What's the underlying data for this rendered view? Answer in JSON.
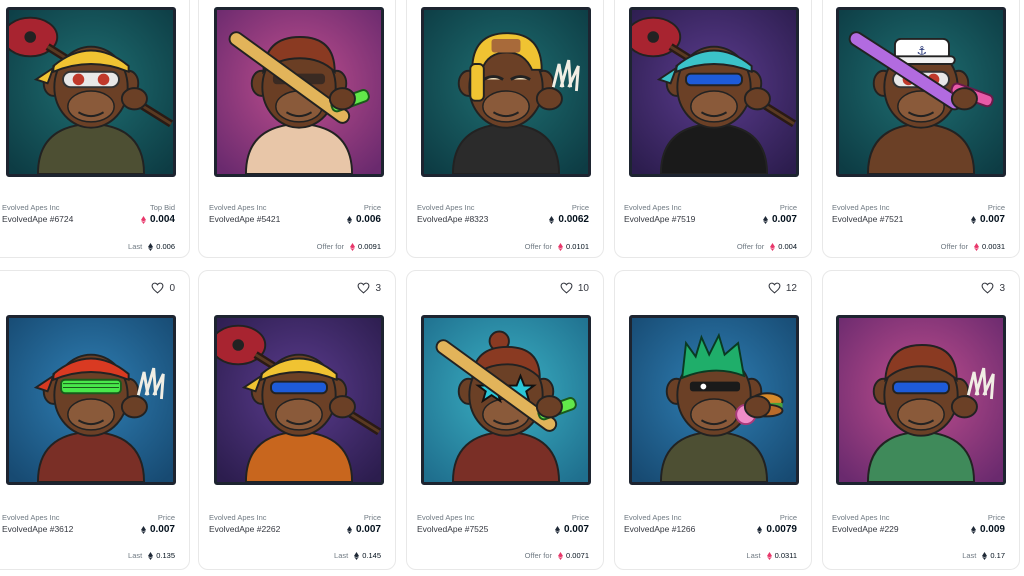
{
  "icons": {
    "favorite": "heart-icon",
    "currency": "ethereum-icon",
    "offer_currency": "weth-icon"
  },
  "colors": {
    "eth": "#1f2937",
    "weth": "#e8376a",
    "muted": "#707a83"
  },
  "cards": [
    {
      "collection": "Evolved Apes Inc",
      "name": "EvolvedApe #6724",
      "price_label": "Top Bid",
      "price": "0.004",
      "price_currency": "weth",
      "footer_label": "Last",
      "footer_value": "0.006",
      "footer_currency": "eth",
      "favorites": null,
      "art": {
        "bg1": "#1f6f72",
        "bg2": "#0d3c44",
        "fur": "#6b4026",
        "shirt": "#4d4f33",
        "hat": "#f0c332",
        "hat_type": "bandana",
        "eyes": "goggles-red",
        "prop": "guitar"
      }
    },
    {
      "collection": "Evolved Apes Inc",
      "name": "EvolvedApe #5421",
      "price_label": "Price",
      "price": "0.006",
      "price_currency": "eth",
      "footer_label": "Offer for",
      "footer_value": "0.0091",
      "footer_currency": "weth",
      "favorites": null,
      "art": {
        "bg1": "#c04f8e",
        "bg2": "#6a2a6e",
        "fur": "#6a3e24",
        "shirt": "#e8c6a8",
        "hat": "#8a3a22",
        "hat_type": "hair",
        "eyes": "shades-dark",
        "prop": "bat"
      }
    },
    {
      "collection": "Evolved Apes Inc",
      "name": "EvolvedApe #8323",
      "price_label": "Price",
      "price": "0.0062",
      "price_currency": "eth",
      "footer_label": "Offer for",
      "footer_value": "0.0101",
      "footer_currency": "weth",
      "favorites": null,
      "art": {
        "bg1": "#1f6f72",
        "bg2": "#0d3c44",
        "fur": "#6b4026",
        "shirt": "#2b2b2b",
        "hat": "#f0c332",
        "hat_type": "ushanka",
        "eyes": "sleepy",
        "prop": "claws"
      }
    },
    {
      "collection": "Evolved Apes Inc",
      "name": "EvolvedApe #7519",
      "price_label": "Price",
      "price": "0.007",
      "price_currency": "eth",
      "footer_label": "Offer for",
      "footer_value": "0.004",
      "footer_currency": "weth",
      "favorites": null,
      "art": {
        "bg1": "#5b3c8e",
        "bg2": "#2c1d4e",
        "fur": "#6b4026",
        "shirt": "#1a1a1a",
        "hat": "#3bc3c9",
        "hat_type": "bandana",
        "eyes": "shades-blue",
        "prop": "guitar"
      }
    },
    {
      "collection": "Evolved Apes Inc",
      "name": "EvolvedApe #7521",
      "price_label": "Price",
      "price": "0.007",
      "price_currency": "eth",
      "footer_label": "Offer for",
      "footer_value": "0.0031",
      "footer_currency": "weth",
      "favorites": null,
      "art": {
        "bg1": "#1f6f72",
        "bg2": "#0d3c44",
        "fur": "#6b4026",
        "shirt": "#6b4026",
        "hat": "#ffffff",
        "hat_type": "sailor",
        "eyes": "goggles-red",
        "prop": "bat-pink"
      }
    },
    {
      "collection": "Evolved Apes Inc",
      "name": "EvolvedApe #3612",
      "price_label": "Price",
      "price": "0.007",
      "price_currency": "eth",
      "footer_label": "Last",
      "footer_value": "0.135",
      "footer_currency": "eth",
      "favorites": "0",
      "art": {
        "bg1": "#2f7fb4",
        "bg2": "#174a72",
        "fur": "#6b4026",
        "shirt": "#7a2f26",
        "hat": "#d93a22",
        "hat_type": "bandana",
        "eyes": "shades-green",
        "prop": "claws"
      }
    },
    {
      "collection": "Evolved Apes Inc",
      "name": "EvolvedApe #2262",
      "price_label": "Price",
      "price": "0.007",
      "price_currency": "eth",
      "footer_label": "Last",
      "footer_value": "0.145",
      "footer_currency": "eth",
      "favorites": "3",
      "art": {
        "bg1": "#5b3c8e",
        "bg2": "#2c1d4e",
        "fur": "#6b4026",
        "shirt": "#c8661e",
        "hat": "#f0c332",
        "hat_type": "bandana",
        "eyes": "shades-blue",
        "prop": "guitar"
      }
    },
    {
      "collection": "Evolved Apes Inc",
      "name": "EvolvedApe #7525",
      "price_label": "Price",
      "price": "0.007",
      "price_currency": "eth",
      "footer_label": "Offer for",
      "footer_value": "0.0071",
      "footer_currency": "weth",
      "favorites": "10",
      "art": {
        "bg1": "#3bb1c4",
        "bg2": "#1f6f8e",
        "fur": "#6b4026",
        "shirt": "#7a2f26",
        "hat": "#8a3a22",
        "hat_type": "bun",
        "eyes": "star-shades",
        "prop": "bat"
      }
    },
    {
      "collection": "Evolved Apes Inc",
      "name": "EvolvedApe #1266",
      "price_label": "Price",
      "price": "0.0079",
      "price_currency": "eth",
      "footer_label": "Last",
      "footer_value": "0.0311",
      "footer_currency": "weth",
      "favorites": "12",
      "art": {
        "bg1": "#2f7fb4",
        "bg2": "#174a72",
        "fur": "#6b4026",
        "shirt": "#4d4f33",
        "hat": "#1fae6a",
        "hat_type": "hair-green",
        "eyes": "visor",
        "prop": "burger"
      }
    },
    {
      "collection": "Evolved Apes Inc",
      "name": "EvolvedApe #229",
      "price_label": "Price",
      "price": "0.009",
      "price_currency": "eth",
      "footer_label": "Last",
      "footer_value": "0.17",
      "footer_currency": "eth",
      "favorites": "3",
      "art": {
        "bg1": "#c04f8e",
        "bg2": "#6a2a6e",
        "fur": "#6b4026",
        "shirt": "#3f8a5a",
        "hat": "#8a3a22",
        "hat_type": "hair",
        "eyes": "shades-blue",
        "prop": "claws"
      }
    }
  ]
}
